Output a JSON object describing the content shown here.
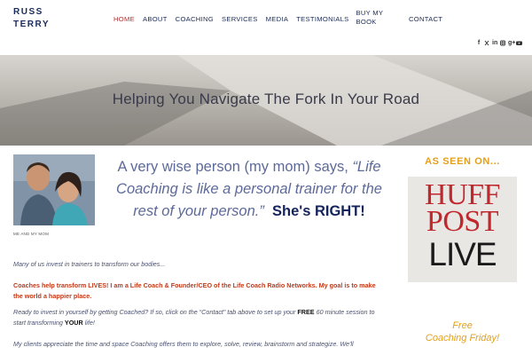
{
  "header": {
    "logo_line1": "RUSS",
    "logo_line2": "TERRY",
    "nav": [
      {
        "label": "HOME"
      },
      {
        "label": "ABOUT"
      },
      {
        "label": "COACHING"
      },
      {
        "label": "SERVICES"
      },
      {
        "label": "MEDIA"
      },
      {
        "label": "TESTIMONIALS"
      },
      {
        "label": "BUY MY BOOK"
      },
      {
        "label": "CONTACT"
      }
    ],
    "social": [
      "f",
      "t",
      "in",
      "ig",
      "g+",
      "yt"
    ],
    "active_color": "#b03030",
    "nav_color": "#1b2b55"
  },
  "hero": {
    "title": "Helping You Navigate The Fork In Your Road"
  },
  "photo": {
    "caption": "ME AND MY MOM"
  },
  "quote": {
    "prefix": "A very wise person (my mom) says, ",
    "quoted": "“Life Coaching is like a personal trainer for the rest of your person.”",
    "emphasis": "She's RIGHT!"
  },
  "body": {
    "p1": "Many of us invest in trainers to transform our bodies...",
    "p2": "Coaches help transform LIVES! I am a Life Coach & Founder/CEO of the Life Coach Radio Networks. My goal is to make the world a happier place.",
    "p3_a": "Ready to invest in yourself by getting Coached? If so, click on the “Contact” tab above to set up your ",
    "p3_free": "FREE",
    "p3_b": " 60 minute session to start transforming ",
    "p3_your": "YOUR",
    "p3_c": " life!",
    "p4": "My clients appreciate the time and space Coaching offers them to explore, solve, review, brainstorm and strategize. We'll"
  },
  "sidebar": {
    "seen_on": "AS SEEN ON...",
    "huff_line1": "HUFF",
    "huff_line2": "POST",
    "huff_line3": "LIVE",
    "coaching_line1": "Free",
    "coaching_line2": "Coaching Friday!",
    "accent": "#e3a01a",
    "huff_red": "#c0282e"
  }
}
